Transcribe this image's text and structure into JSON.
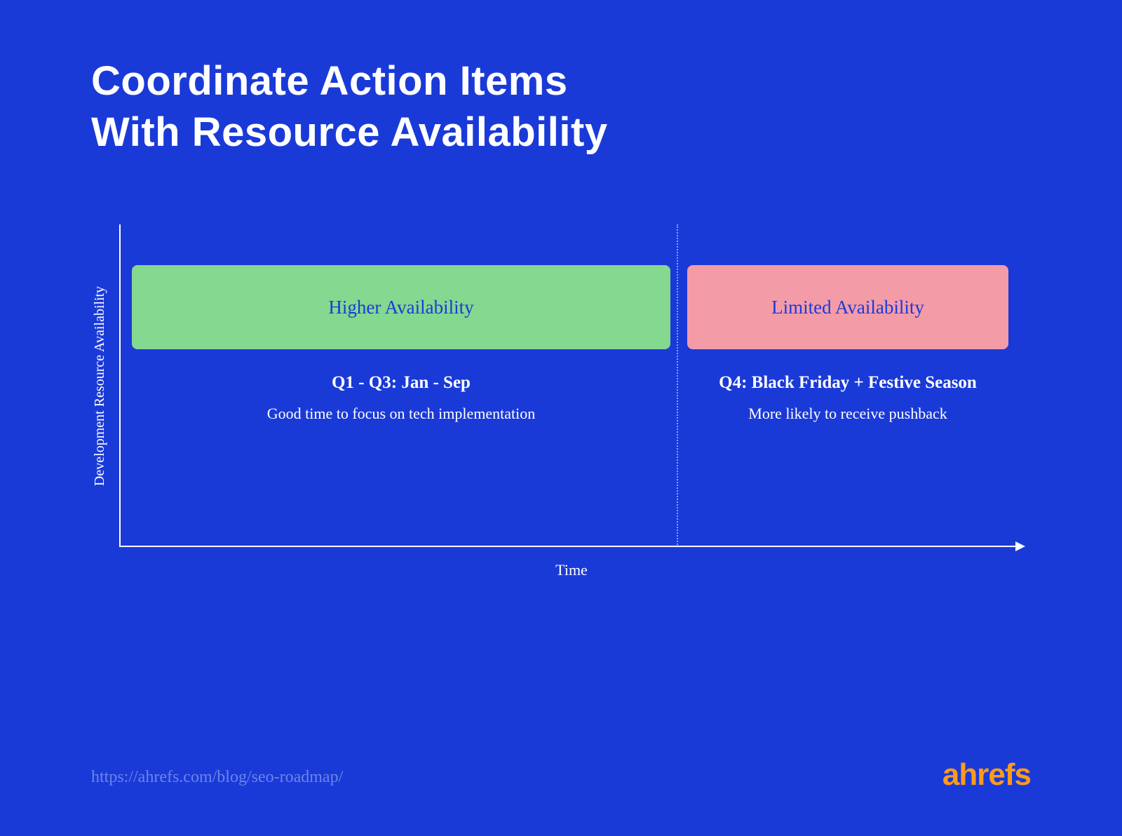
{
  "title_line1": "Coordinate Action Items",
  "title_line2": "With Resource Availability",
  "axes": {
    "y": "Development Resource Availability",
    "x": "Time"
  },
  "segments": {
    "left": {
      "bar_label": "Higher Availability",
      "caption_title": "Q1 - Q3: Jan - Sep",
      "caption_sub": "Good time to focus on tech implementation"
    },
    "right": {
      "bar_label": "Limited Availability",
      "caption_title": "Q4: Black Friday + Festive Season",
      "caption_sub": "More likely to receive pushback"
    }
  },
  "footer": {
    "url": "https://ahrefs.com/blog/seo-roadmap/",
    "logo": "ahrefs"
  },
  "chart_data": {
    "type": "bar",
    "title": "Coordinate Action Items With Resource Availability",
    "xlabel": "Time",
    "ylabel": "Development Resource Availability",
    "categories": [
      "Q1 - Q3: Jan - Sep",
      "Q4: Black Friday + Festive Season"
    ],
    "series": [
      {
        "name": "Availability",
        "values": [
          "Higher Availability",
          "Limited Availability"
        ],
        "colors": [
          "#84d890",
          "#f49ba8"
        ],
        "notes": [
          "Good time to focus on tech implementation",
          "More likely to receive pushback"
        ]
      }
    ]
  }
}
